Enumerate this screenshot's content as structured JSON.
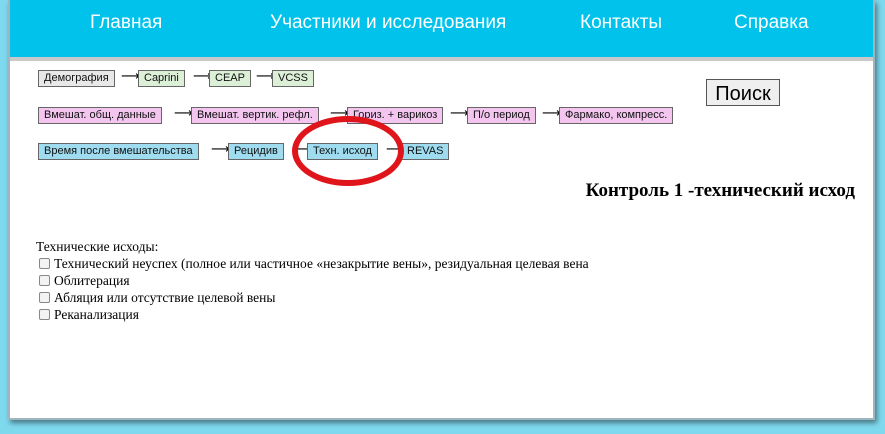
{
  "nav": {
    "home": "Главная",
    "participants": "Участники и исследования",
    "contacts": "Контакты",
    "help": "Справка"
  },
  "steps_row1": [
    "Демография",
    "Caprini",
    "CEAP",
    "VCSS"
  ],
  "steps_row2": [
    "Вмешат. общ. данные",
    "Вмешат. вертик. рефл.",
    "Гориз. + варикоз",
    "П/о период",
    "Фармако, компресс."
  ],
  "steps_row3": [
    "Время после вмешательства",
    "Рецидив",
    "Техн. исход",
    "REVAS"
  ],
  "arrow": "⟶",
  "search": {
    "label": "Поиск"
  },
  "page": {
    "title": "Контроль 1 -технический исход"
  },
  "outcomes": {
    "heading": "Технические исходы:",
    "items": [
      "Технический неуспех (полное или частичное «незакрытие вены», резидуальная целевая вена",
      "Облитерация",
      "Абляция или отсутствие целевой вены",
      "Реканализация"
    ]
  },
  "colors": {
    "navbar": "#00c2ea",
    "background": "#7fd9ee",
    "highlight": "#e0141b"
  }
}
